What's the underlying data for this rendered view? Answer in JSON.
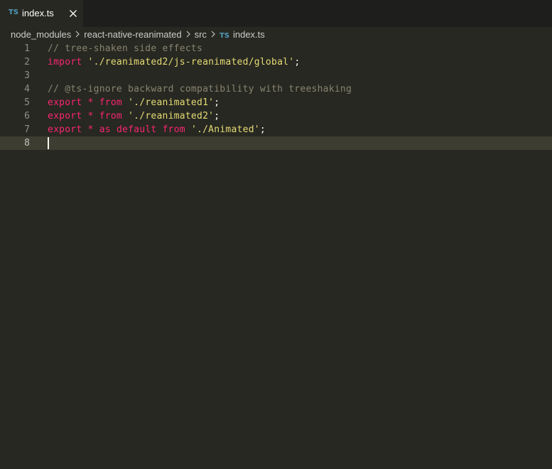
{
  "tab": {
    "icon_label": "TS",
    "label": "index.ts",
    "close_icon": "close-icon"
  },
  "breadcrumb": {
    "items": [
      "node_modules",
      "react-native-reanimated",
      "src",
      "index.ts"
    ],
    "file_icon_label": "TS"
  },
  "editor": {
    "lines": [
      {
        "number": "1",
        "tokens": [
          {
            "t": "comment",
            "v": "// tree-shaken side effects"
          }
        ]
      },
      {
        "number": "2",
        "tokens": [
          {
            "t": "keyword",
            "v": "import"
          },
          {
            "t": "punct",
            "v": " "
          },
          {
            "t": "string",
            "v": "'./reanimated2/js-reanimated/global'"
          },
          {
            "t": "punct",
            "v": ";"
          }
        ]
      },
      {
        "number": "3",
        "tokens": []
      },
      {
        "number": "4",
        "tokens": [
          {
            "t": "comment",
            "v": "// @ts-ignore backward compatibility with treeshaking"
          }
        ]
      },
      {
        "number": "5",
        "tokens": [
          {
            "t": "keyword",
            "v": "export"
          },
          {
            "t": "punct",
            "v": " "
          },
          {
            "t": "keyword",
            "v": "*"
          },
          {
            "t": "punct",
            "v": " "
          },
          {
            "t": "keyword",
            "v": "from"
          },
          {
            "t": "punct",
            "v": " "
          },
          {
            "t": "string",
            "v": "'./reanimated1'"
          },
          {
            "t": "punct",
            "v": ";"
          }
        ]
      },
      {
        "number": "6",
        "tokens": [
          {
            "t": "keyword",
            "v": "export"
          },
          {
            "t": "punct",
            "v": " "
          },
          {
            "t": "keyword",
            "v": "*"
          },
          {
            "t": "punct",
            "v": " "
          },
          {
            "t": "keyword",
            "v": "from"
          },
          {
            "t": "punct",
            "v": " "
          },
          {
            "t": "string",
            "v": "'./reanimated2'"
          },
          {
            "t": "punct",
            "v": ";"
          }
        ]
      },
      {
        "number": "7",
        "tokens": [
          {
            "t": "keyword",
            "v": "export"
          },
          {
            "t": "punct",
            "v": " "
          },
          {
            "t": "keyword",
            "v": "*"
          },
          {
            "t": "punct",
            "v": " "
          },
          {
            "t": "keyword",
            "v": "as"
          },
          {
            "t": "punct",
            "v": " "
          },
          {
            "t": "keyword",
            "v": "default"
          },
          {
            "t": "punct",
            "v": " "
          },
          {
            "t": "keyword",
            "v": "from"
          },
          {
            "t": "punct",
            "v": " "
          },
          {
            "t": "string",
            "v": "'./Animated'"
          },
          {
            "t": "punct",
            "v": ";"
          }
        ]
      },
      {
        "number": "8",
        "tokens": [],
        "current": true
      }
    ]
  },
  "colors": {
    "background": "#272822",
    "comment": "#88846f",
    "keyword": "#f92672",
    "string": "#e6db74",
    "text": "#f8f8f2",
    "ts_icon": "#519aba"
  }
}
